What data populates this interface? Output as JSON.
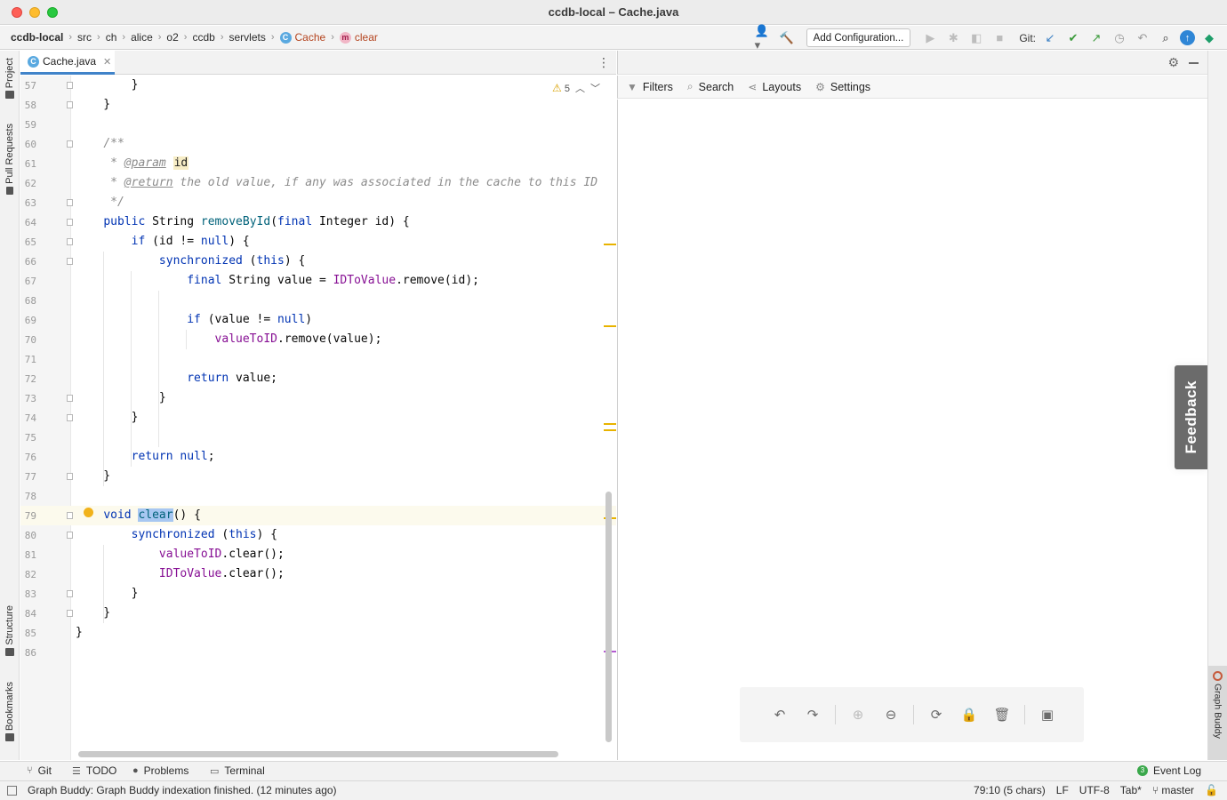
{
  "window": {
    "title": "ccdb-local – Cache.java"
  },
  "breadcrumbs": {
    "items": [
      "ccdb-local",
      "src",
      "ch",
      "alice",
      "o2",
      "ccdb",
      "servlets"
    ],
    "class_icon": "C",
    "class_name": "Cache",
    "method_icon": "m",
    "method_name": "clear"
  },
  "toolbar": {
    "add_configuration": "Add Configuration...",
    "git_label": "Git:"
  },
  "left_stripe": {
    "project": "Project",
    "pull_requests": "Pull Requests",
    "structure": "Structure",
    "bookmarks": "Bookmarks"
  },
  "right_stripe": {
    "graph_buddy": "Graph Buddy"
  },
  "editor": {
    "tab": {
      "icon": "C",
      "label": "Cache.java"
    },
    "warnings": {
      "count": "5"
    },
    "lines": [
      {
        "n": "57",
        "fold": true
      },
      {
        "n": "58",
        "fold": true
      },
      {
        "n": "59"
      },
      {
        "n": "60",
        "fold": true
      },
      {
        "n": "61"
      },
      {
        "n": "62"
      },
      {
        "n": "63",
        "fold": true
      },
      {
        "n": "64",
        "fold": true
      },
      {
        "n": "65",
        "fold": true
      },
      {
        "n": "66",
        "fold": true
      },
      {
        "n": "67"
      },
      {
        "n": "68"
      },
      {
        "n": "69"
      },
      {
        "n": "70"
      },
      {
        "n": "71"
      },
      {
        "n": "72"
      },
      {
        "n": "73",
        "fold": true
      },
      {
        "n": "74",
        "fold": true
      },
      {
        "n": "75"
      },
      {
        "n": "76"
      },
      {
        "n": "77",
        "fold": true
      },
      {
        "n": "78"
      },
      {
        "n": "79",
        "fold": true
      },
      {
        "n": "80",
        "fold": true
      },
      {
        "n": "81"
      },
      {
        "n": "82"
      },
      {
        "n": "83",
        "fold": true
      },
      {
        "n": "84",
        "fold": true
      },
      {
        "n": "85"
      },
      {
        "n": "86"
      }
    ]
  },
  "graph_panel": {
    "tools": {
      "filters": "Filters",
      "search": "Search",
      "layouts": "Layouts",
      "settings": "Settings"
    },
    "feedback": "Feedback"
  },
  "bottom_tools": {
    "git": "Git",
    "todo": "TODO",
    "problems": "Problems",
    "terminal": "Terminal",
    "event_log": "Event Log",
    "event_count": "3"
  },
  "status": {
    "message": "Graph Buddy: Graph Buddy indexation finished. (12 minutes ago)",
    "position": "79:10 (5 chars)",
    "line_sep": "LF",
    "encoding": "UTF-8",
    "indent": "Tab*",
    "branch": "master"
  },
  "colors": {
    "accent": "#4083c9",
    "keyword": "#0033b3",
    "field": "#871094",
    "method": "#00627a",
    "warning": "#e8b300"
  }
}
